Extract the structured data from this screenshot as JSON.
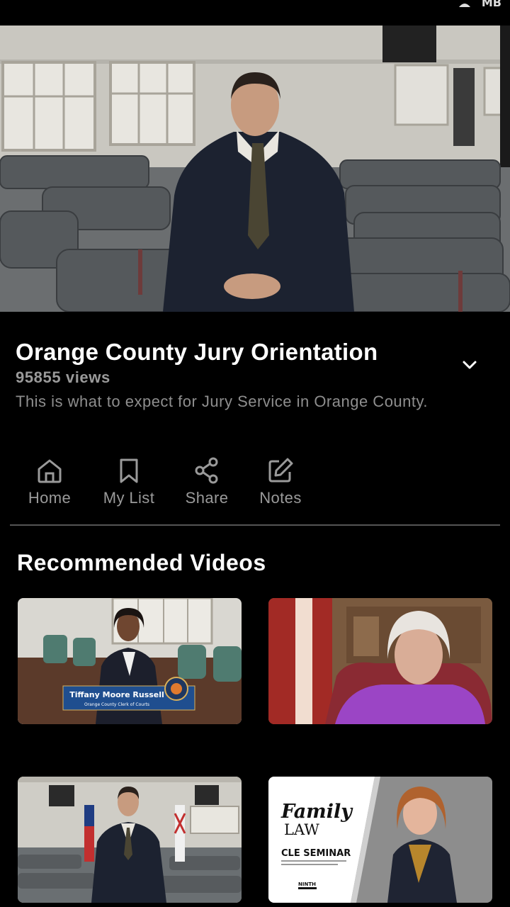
{
  "status": {
    "right_text": "MB"
  },
  "video": {
    "title": "Orange County Jury Orientation",
    "views": "95855 views",
    "description": "This is what to expect for Jury Service in Orange County."
  },
  "actions": [
    {
      "label": "Home",
      "icon": "home-icon"
    },
    {
      "label": "My List",
      "icon": "bookmark-icon"
    },
    {
      "label": "Share",
      "icon": "share-icon"
    },
    {
      "label": "Notes",
      "icon": "edit-icon"
    }
  ],
  "recommended": {
    "title": "Recommended Videos",
    "items": [
      {
        "lower_third_name": "Tiffany Moore Russell",
        "lower_third_subtitle": "Orange County Clerk of Courts"
      },
      {},
      {},
      {
        "overlay_title_1": "Family",
        "overlay_title_2": "LAW",
        "overlay_subtitle": "CLE SEMINAR",
        "overlay_logo": "NINTH"
      }
    ]
  },
  "colors": {
    "background": "#000000",
    "muted_text": "#9a9a9a",
    "divider": "#555555"
  }
}
